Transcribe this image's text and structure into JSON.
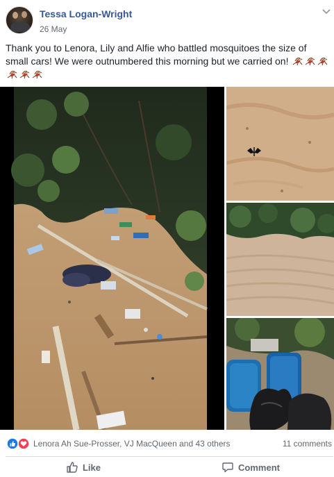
{
  "post": {
    "author": "Tessa Logan-Wright",
    "date": "26 May",
    "text": "Thank you to Lenora, Lily and Alfie who battled mosquitoes the size of small cars! We were outnumbered this morning but we carried on!",
    "emoji_name": "mosquito-emoji",
    "emoji_count": 6
  },
  "icons": {
    "menu": "chevron-down-icon",
    "like_reaction": "like-reaction-icon",
    "love_reaction": "love-reaction-icon",
    "like_action": "thumbs-up-icon",
    "comment_action": "speech-bubble-icon"
  },
  "photos": [
    {
      "name": "photo-rubbish-on-beach",
      "description": "Rubbish, bottles, clothes and driftwood on sand under trees"
    },
    {
      "name": "photo-butterfly-on-sand",
      "description": "Black butterfly on sand"
    },
    {
      "name": "photo-cleared-sand",
      "description": "Cleared sand beneath bushes"
    },
    {
      "name": "photo-collected-rubbish",
      "description": "Blue barrels and black rubbish bags"
    }
  ],
  "stats": {
    "reactors": "Lenora Ah Sue-Prosser, VJ MacQueen and 43 others",
    "comments": "11 comments"
  },
  "actions": {
    "like": "Like",
    "comment": "Comment"
  },
  "colors": {
    "author_link": "#365899",
    "like_blue": "#1877f2",
    "love_red": "#f33e58",
    "muted_text": "#616770"
  }
}
